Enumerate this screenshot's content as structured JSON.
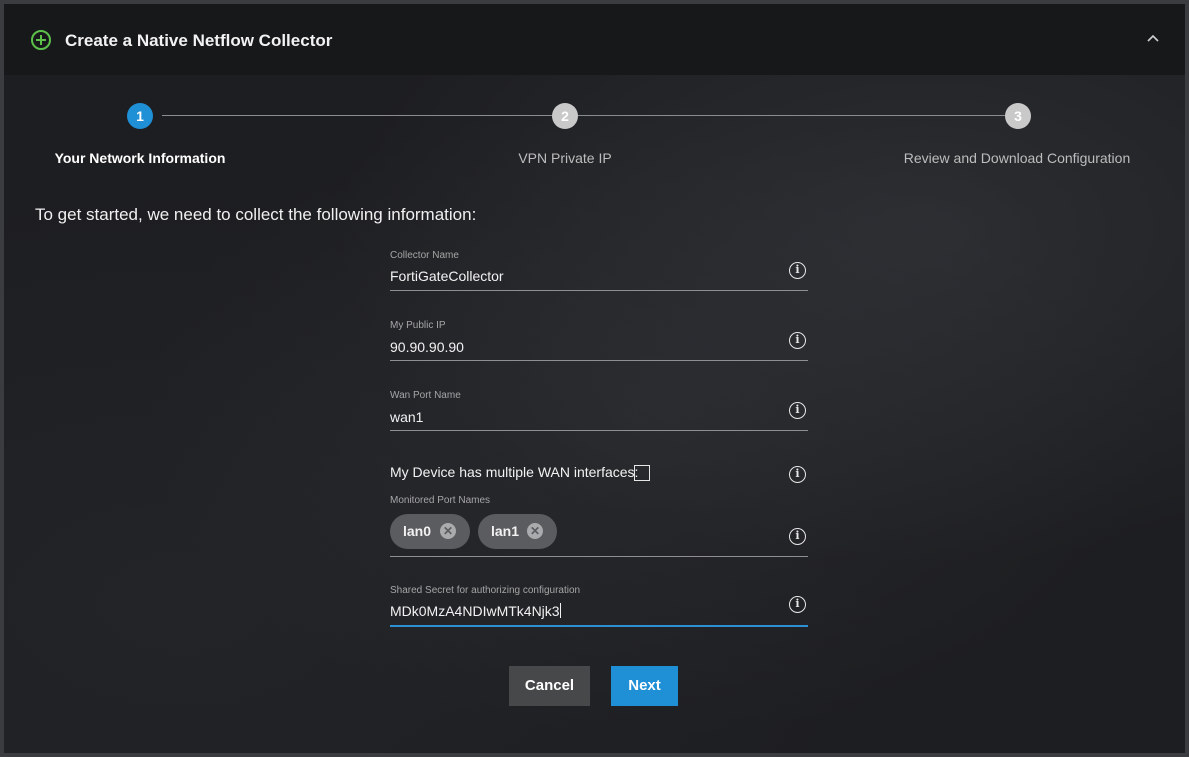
{
  "header": {
    "title": "Create a Native Netflow Collector",
    "add_icon": "plus-circle-icon",
    "collapse_icon": "chevron-up-icon",
    "accent": "#5cc04a"
  },
  "steps": [
    {
      "number": "1",
      "label": "Your Network Information",
      "active": true
    },
    {
      "number": "2",
      "label": "VPN Private IP",
      "active": false
    },
    {
      "number": "3",
      "label": "Review and Download Configuration",
      "active": false
    }
  ],
  "intro": "To get started, we need to collect the following information:",
  "form": {
    "collector_name": {
      "label": "Collector Name",
      "value": "FortiGateCollector"
    },
    "public_ip": {
      "label": "My Public IP",
      "value": "90.90.90.90"
    },
    "wan_port": {
      "label": "Wan Port Name",
      "value": "wan1"
    },
    "multiple_wan": {
      "label": "My Device has multiple WAN interfaces:",
      "checked": false
    },
    "monitored_ports": {
      "label": "Monitored Port Names",
      "chips": [
        "lan0",
        "lan1"
      ]
    },
    "shared_secret": {
      "label": "Shared Secret for authorizing configuration",
      "value": "MDk0MzA4NDIwMTk4Njk3"
    }
  },
  "buttons": {
    "cancel": "Cancel",
    "next": "Next"
  },
  "colors": {
    "primary": "#1f8fd6",
    "background": "#1d1e21"
  }
}
